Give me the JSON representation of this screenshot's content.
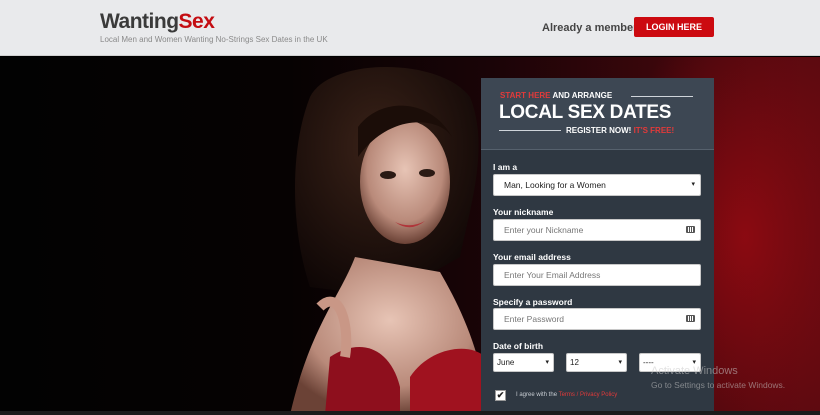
{
  "header": {
    "logo_main": "Wanting",
    "logo_accent": "Sex",
    "tagline": "Local Men and Women Wanting No-Strings Sex Dates in the UK",
    "member_prompt": "Already a member?",
    "login_label": "LOGIN HERE"
  },
  "form_header": {
    "start_here": "START HERE",
    "and_arrange": "AND ARRANGE",
    "title": "LOCAL SEX DATES",
    "register": "REGISTER NOW!",
    "free": "IT'S FREE!"
  },
  "form": {
    "iam_label": "I am a",
    "iam_value": "Man, Looking for a Women",
    "nickname_label": "Your nickname",
    "nickname_placeholder": "Enter your Nickname",
    "email_label": "Your email address",
    "email_placeholder": "Enter Your Email Address",
    "password_label": "Specify a password",
    "password_placeholder": "Enter Password",
    "dob_label": "Date of birth",
    "dob_month": "June",
    "dob_day": "12",
    "dob_year": "----",
    "agree_prefix": "I agree with the",
    "terms": "Terms",
    "separator": "/",
    "privacy": "Privacy Policy",
    "agree_checked": "✔"
  },
  "watermark": {
    "line1": "Activate Windows",
    "line2": "Go to Settings to activate Windows."
  },
  "colors": {
    "brand_red": "#cc0a10",
    "panel_bg": "#2f3842",
    "header_bg": "#e9eaec"
  },
  "icons": {
    "caret": "▾",
    "key": "password-key-icon"
  }
}
